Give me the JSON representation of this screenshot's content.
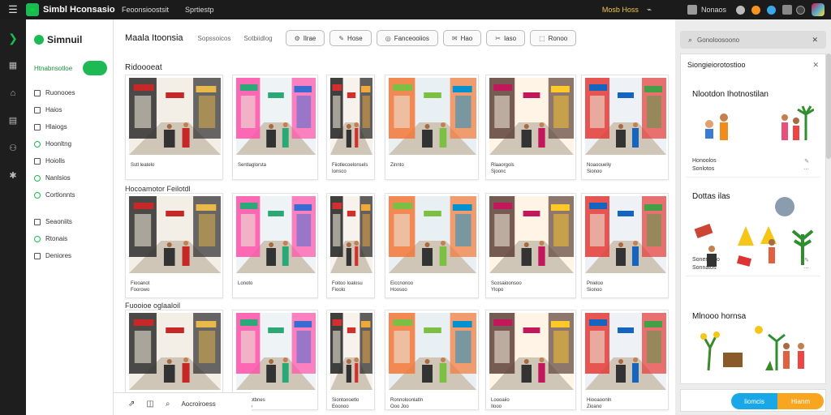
{
  "topbar": {
    "app_name": "Simbl Hconsasio",
    "nav": [
      "Feoonsioostsit",
      "Sprtiestp"
    ],
    "badge_text": "Mosb Hoss",
    "user_name": "Nonaos"
  },
  "sidebar": {
    "brand": "Simnuil",
    "active_item": "Htnabnsotloe",
    "items": [
      "Ruonooes",
      "Haios",
      "Hlaiogs",
      "Hoonltng",
      "Hoiolls",
      "Nanlsios",
      "Cortlonnts"
    ],
    "items_bottom": [
      "Seaoniits",
      "Rtonais",
      "Deniores"
    ]
  },
  "main": {
    "title": "Maala Itoonsia",
    "tabs": [
      "Sopssoicos",
      "Sotbiidlog"
    ],
    "buttons": [
      {
        "icon": "⚙",
        "label": "Ilrae"
      },
      {
        "icon": "✎",
        "label": "Hose"
      },
      {
        "icon": "◎",
        "label": "Fanceooiios"
      },
      {
        "icon": "✉",
        "label": "Hao"
      },
      {
        "icon": "✂",
        "label": "Iaso"
      },
      {
        "icon": "⬚",
        "label": "Ronoo"
      }
    ],
    "sections": [
      {
        "title": "Ridoooeat"
      },
      {
        "title": "Hocoamotor Feilotdl"
      },
      {
        "title": "Fuooioe oglaaloil"
      }
    ],
    "rows": [
      [
        {
          "c1": "Sstl leatelo",
          "c2": ""
        },
        {
          "c1": "Sentlaglorsta",
          "c2": ""
        },
        {
          "c1": "Fiiotlecoelonsels",
          "c2": "Ionsco"
        },
        {
          "c1": "Zinnto",
          "c2": ""
        },
        {
          "c1": "Rlaaorgols",
          "c2": "Sjoonc"
        },
        {
          "c1": "Noaooueliy",
          "c2": "Sionoo"
        }
      ],
      [
        {
          "c1": "Fiooanot",
          "c2": "Foorowo"
        },
        {
          "c1": "Lonoto",
          "c2": ""
        },
        {
          "c1": "Foitoo Ioalosu",
          "c2": "Fioolo"
        },
        {
          "c1": "Eiccnonoo",
          "c2": "Hoosoo"
        },
        {
          "c1": "Scosaioonsoo",
          "c2": "Ylopo"
        },
        {
          "c1": "Pnieloo",
          "c2": "Sionoo"
        }
      ],
      [
        {
          "c1": "",
          "c2": ""
        },
        {
          "c1": "Ranalotbnes",
          "c2": "Ronno"
        },
        {
          "c1": "Siontonoetlo",
          "c2": "Eoonoo"
        },
        {
          "c1": "Ronnoloonlatln",
          "c2": "Ooo Joo"
        },
        {
          "c1": "Loooaiio",
          "c2": "Ilooo"
        },
        {
          "c1": "Hiooaoonln",
          "c2": "Zioano"
        }
      ]
    ]
  },
  "bottom_bar": {
    "label": "Aocroiroess"
  },
  "right_panel": {
    "search_placeholder": "Gonoloosoono",
    "header": "Siongieiorotostioo",
    "cards": [
      {
        "title": "Nlootdon Ihotnostilan",
        "meta1": "Honoolos",
        "meta2": "Sonlotos"
      },
      {
        "title": "Dottas ilas",
        "meta1": "Sonenomo",
        "meta2": "Sonnatos"
      },
      {
        "title": "Mlnooo hornsa",
        "meta1": "",
        "meta2": ""
      }
    ],
    "cta_left": "Iiomcis",
    "cta_right": "Hianm"
  },
  "colors": {
    "accent": "#1db954",
    "topbar": "#1b1b1b",
    "cta_blue": "#1aa7e8",
    "cta_orange": "#f8a51f"
  }
}
